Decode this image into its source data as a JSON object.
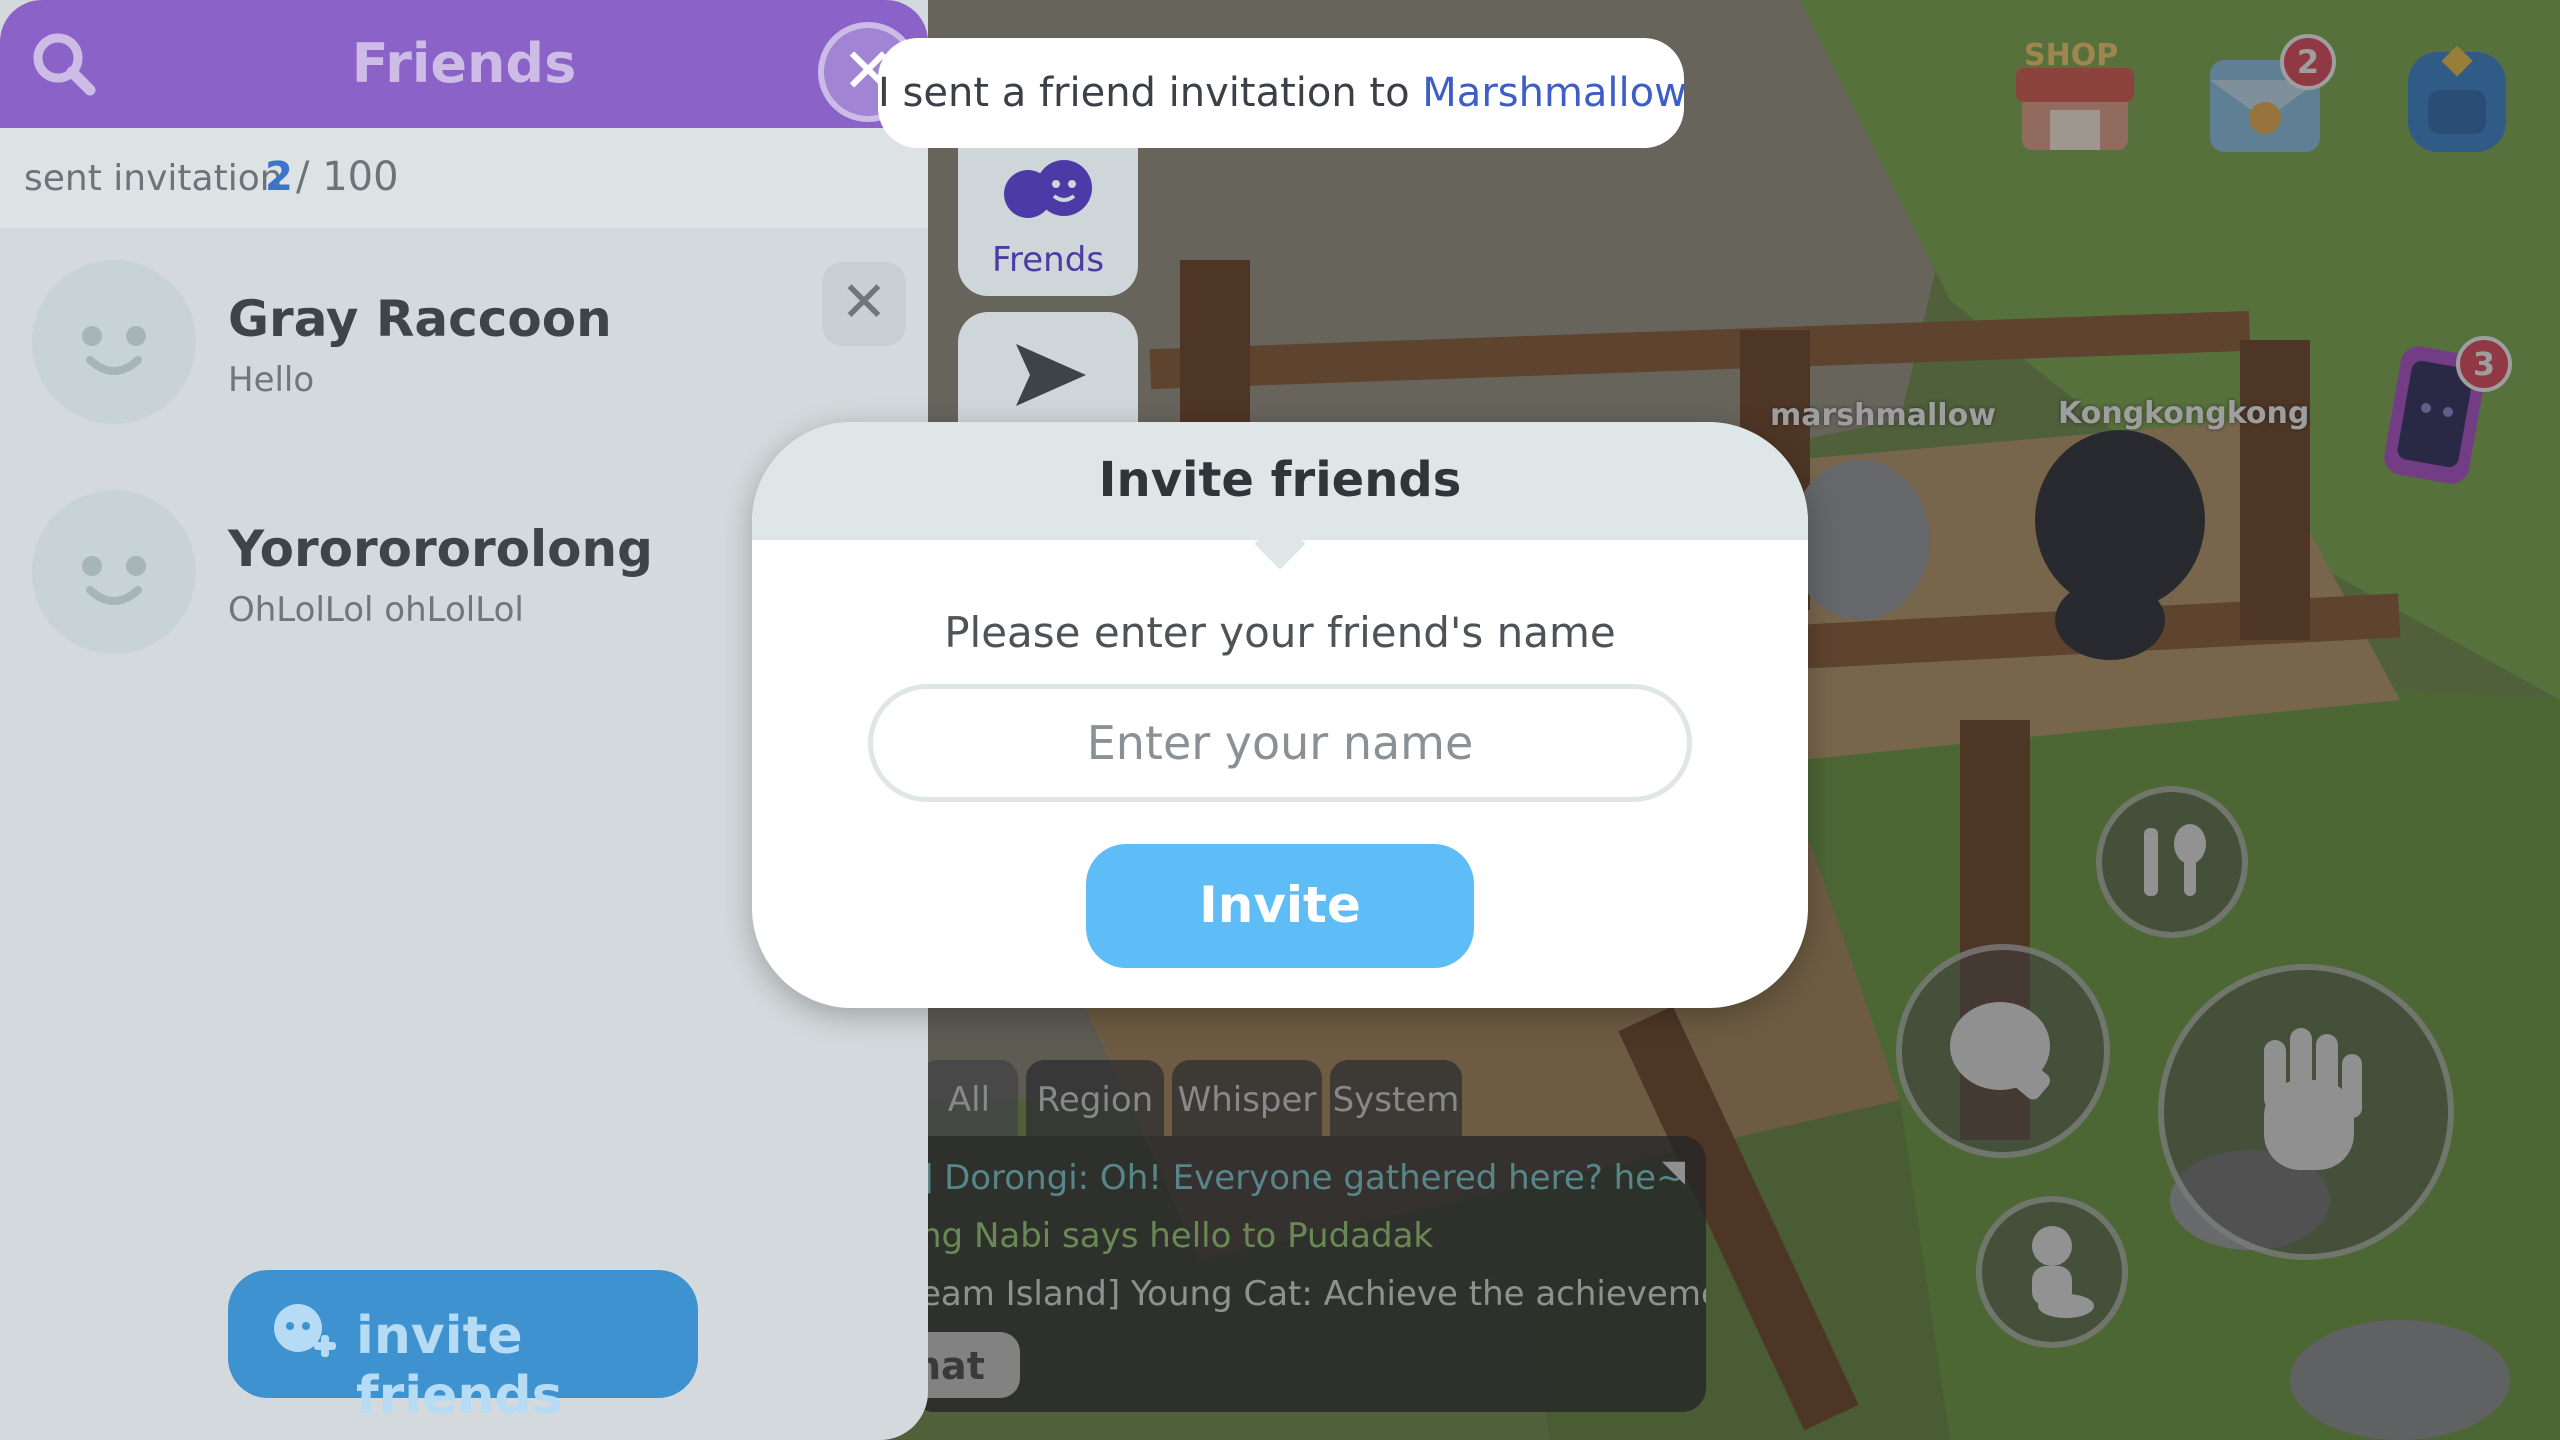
{
  "friends_panel": {
    "title": "Friends",
    "search_icon": "search-icon",
    "close_icon": "close-icon",
    "invite_count": {
      "label": "sent invitation",
      "current": "2",
      "total": "/ 100"
    },
    "friends": [
      {
        "name": "Gray Raccoon",
        "status": "Hello"
      },
      {
        "name": "Yororororolong",
        "status": "OhLolLol ohLolLol"
      }
    ],
    "invite_button": {
      "label": "invite friends",
      "icon": "add-friend-icon"
    }
  },
  "side_tabs": [
    {
      "label": "Frends",
      "icon": "friends-icon"
    },
    {
      "label": "",
      "icon": "send-icon"
    }
  ],
  "toast": {
    "prefix": "I sent a friend invitation to ",
    "target": "Marshmallow"
  },
  "hud": {
    "shop_label": "SHOP",
    "mail_badge": "2",
    "phone_badge": "3"
  },
  "players": [
    {
      "name": "marshmallow"
    },
    {
      "name": "Kongkongkong"
    }
  ],
  "chat": {
    "tabs": [
      "All",
      "Region",
      "Whisper",
      "System"
    ],
    "lines": [
      {
        "text": "] Dorongi: Oh! Everyone gathered here? he~",
        "color": "#7fd2d9"
      },
      {
        "text": "ng Nabi says hello to Pudadak",
        "color": "#9fd87b"
      },
      {
        "text": "eam Island] Young Cat: Achieve the achievement.",
        "color": "#e6e6e6"
      }
    ],
    "input_label": "hat"
  },
  "modal": {
    "title": "Invite friends",
    "prompt": "Please enter your friend's name",
    "input_value": "",
    "input_placeholder": "Enter your name",
    "button_label": "Invite"
  },
  "colors": {
    "panel_header": "#8b63c8",
    "invite_blue": "#5ebcf7",
    "toast_highlight": "#3d5ec9",
    "badge_red": "#e5485d"
  }
}
